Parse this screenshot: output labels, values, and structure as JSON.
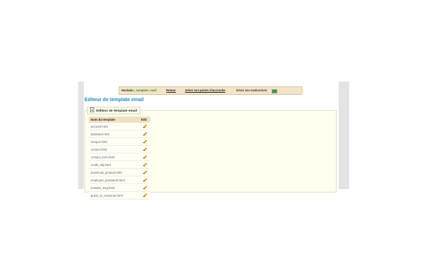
{
  "toolbar": {
    "module_label": "Module",
    "module_name": "ec_template_mail",
    "back_label": "Retour",
    "hooks_label": "Gérer ses points d'accroche",
    "translations_label": "Gérer ses traductions",
    "flags": [
      {
        "name": "en-flag",
        "color": "#2b4a9c"
      },
      {
        "name": "fr-flag",
        "color": "#3a5bc0"
      },
      {
        "name": "es-flag",
        "color": "#d8362b"
      },
      {
        "name": "de-flag",
        "color": "#d9a21b"
      },
      {
        "name": "it-flag",
        "color": "#3b9b3b"
      }
    ]
  },
  "page": {
    "title": "Editeur de template email"
  },
  "panel": {
    "legend": "Editeur de template email",
    "columns": {
      "name": "Nom du template",
      "edit": "Edit"
    },
    "rows": [
      "account.html",
      "bankwire.html",
      "cheque.html",
      "contact.html",
      "contact_form.html",
      "credit_slip.html",
      "download_product.html",
      "employee_password.html",
      "forward_msg.html",
      "guest_to_customer.html"
    ]
  }
}
